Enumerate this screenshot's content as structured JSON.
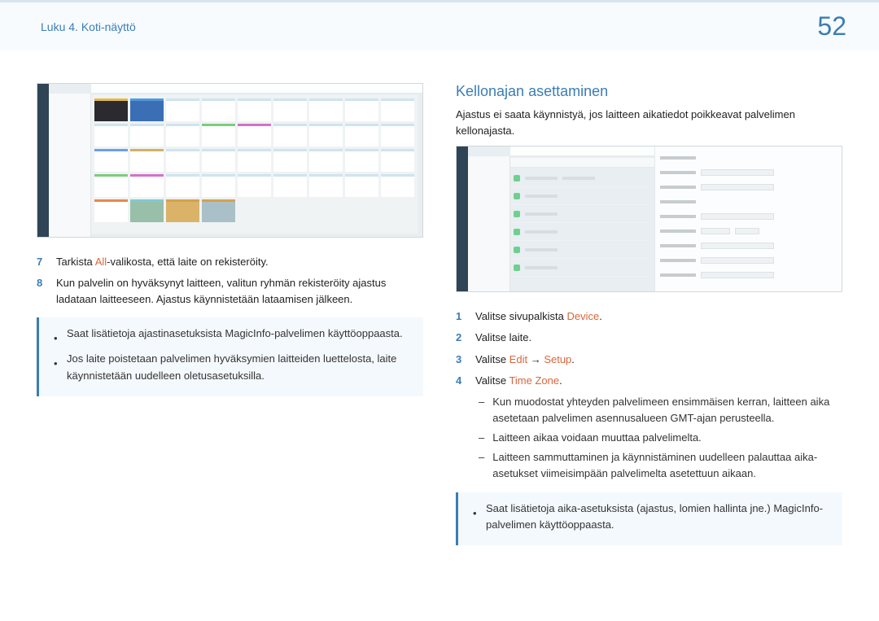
{
  "header": {
    "chapter": "Luku 4. Koti-näyttö",
    "page": "52"
  },
  "left": {
    "steps": [
      {
        "num": "7",
        "pre": "Tarkista ",
        "hl": "All",
        "post": "-valikosta, että laite on rekisteröity."
      },
      {
        "num": "8",
        "text": "Kun palvelin on hyväksynyt laitteen, valitun ryhmän rekisteröity ajastus ladataan laitteeseen. Ajastus käynnistetään lataamisen jälkeen."
      }
    ],
    "info": [
      "Saat lisätietoja ajastinasetuksista MagicInfo-palvelimen käyttöoppaasta.",
      "Jos laite poistetaan palvelimen hyväksymien laitteiden luettelosta, laite käynnistetään uudelleen oletusasetuksilla."
    ]
  },
  "right": {
    "title": "Kellonajan asettaminen",
    "intro": "Ajastus ei saata käynnistyä, jos laitteen aikatiedot poikkeavat palvelimen kellonajasta.",
    "steps": {
      "s1": {
        "num": "1",
        "pre": "Valitse sivupalkista ",
        "hl": "Device",
        "post": "."
      },
      "s2": {
        "num": "2",
        "text": "Valitse laite."
      },
      "s3": {
        "num": "3",
        "pre": "Valitse ",
        "hl1": "Edit",
        "arrow": " → ",
        "hl2": "Setup",
        "post": "."
      },
      "s4": {
        "num": "4",
        "pre": "Valitse ",
        "hl": "Time Zone",
        "post": "."
      }
    },
    "dashes": [
      "Kun muodostat yhteyden palvelimeen ensimmäisen kerran, laitteen aika asetetaan palvelimen asennusalueen GMT-ajan perusteella.",
      "Laitteen aikaa voidaan muuttaa palvelimelta.",
      "Laitteen sammuttaminen ja käynnistäminen uudelleen palauttaa aika-asetukset viimeisimpään palvelimelta asetettuun aikaan."
    ],
    "info": [
      "Saat lisätietoja aika-asetuksista (ajastus, lomien hallinta jne.) MagicInfo-palvelimen käyttöoppaasta."
    ]
  }
}
